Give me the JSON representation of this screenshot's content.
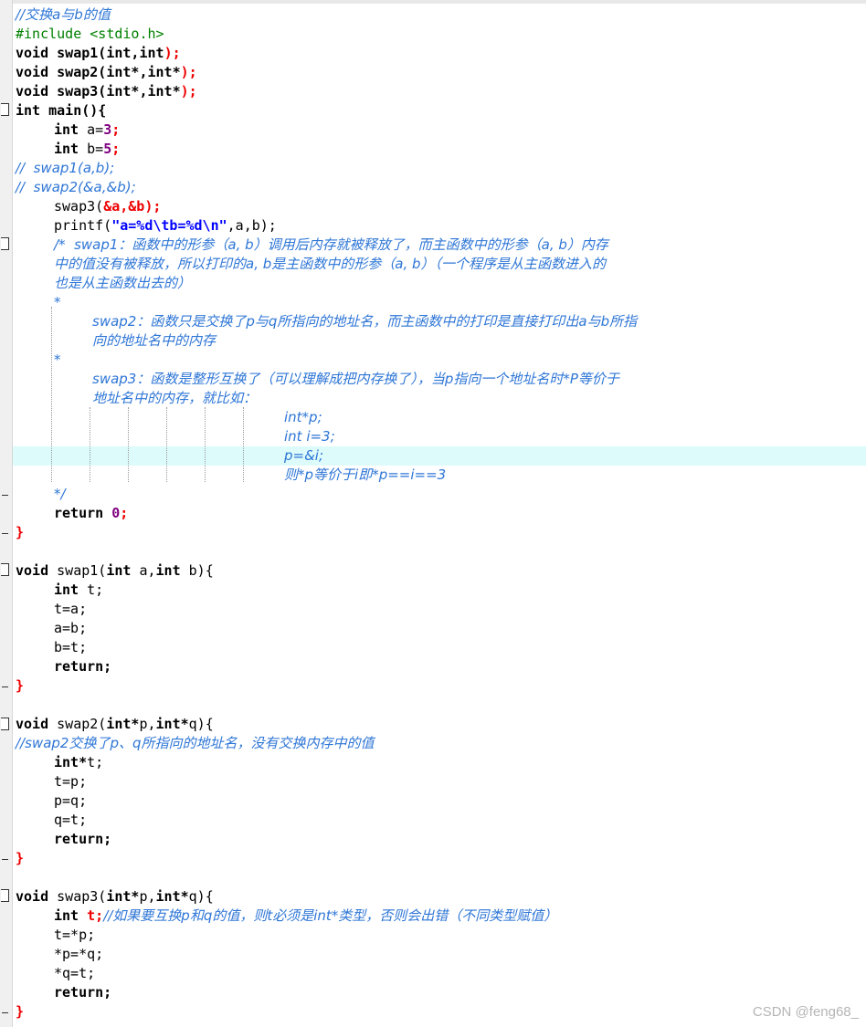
{
  "editor": {
    "lines": {
      "l1": "//交换a与b的值",
      "l2": "#include <stdio.h>",
      "l3a": "void",
      "l3b": " swap1(",
      "l3c": "int,int",
      "l3d": ");",
      "l4a": "void",
      "l4b": " swap2(",
      "l4c": "int*,int*",
      "l4d": ");",
      "l5a": "void",
      "l5b": " swap3(",
      "l5c": "int*,int*",
      "l5d": ");",
      "l6a": "int",
      "l6b": " main(){",
      "l7a": "int",
      "l7b": " a=",
      "l7c": "3",
      "l7d": ";",
      "l8a": "int",
      "l8b": " b=",
      "l8c": "5",
      "l8d": ";",
      "l9": "//  swap1(a,b);",
      "l10": "//  swap2(&a,&b);",
      "l11a": "swap3(",
      "l11b": "&a,&b",
      "l11c": ");",
      "l12a": "printf(",
      "l12b": "\"a=%d\\tb=%d\\n\"",
      "l12c": ",a,b);",
      "l13": "/*  swap1：函数中的形参（a, b）调用后内存就被释放了，而主函数中的形参（a, b）内存",
      "l14": "中的值没有被释放，所以打印的a, b是主函数中的形参（a, b）（一个程序是从主函数进入的",
      "l15": "也是从主函数出去的）",
      "l16": "*",
      "l17": "swap2：函数只是交换了p与q所指向的地址名，而主函数中的打印是直接打印出a与b所指",
      "l18": "向的地址名中的内存",
      "l19": "*",
      "l20": "swap3：函数是整形互换了（可以理解成把内存换了），当p指向一个地址名时*P等价于",
      "l21": "地址名中的内存，就比如：",
      "l22": "int*p;",
      "l23": "int i=3;",
      "l24": "p=&i;",
      "l25": "则*p等价于i即*p==i==3",
      "l26": "*/",
      "l27a": "return",
      "l27b": " 0",
      "l27c": ";",
      "l28": "}",
      "l30a": "void",
      "l30b": " swap1(",
      "l30c": "int",
      "l30d": " a,",
      "l30e": "int",
      "l30f": " b){",
      "l31a": "int",
      "l31b": " t;",
      "l32": "t=a;",
      "l33": "a=b;",
      "l34": "b=t;",
      "l35": "return;",
      "l36": "}",
      "l38a": "void",
      "l38b": " swap2(",
      "l38c": "int*",
      "l38d": "p,",
      "l38e": "int*",
      "l38f": "q){",
      "l39": "//swap2交换了p、q所指向的地址名，没有交换内存中的值",
      "l40a": "int*",
      "l40b": "t;",
      "l41": "t=p;",
      "l42": "p=q;",
      "l43": "q=t;",
      "l44": "return;",
      "l45": "}",
      "l47a": "void",
      "l47b": " swap3(",
      "l47c": "int*",
      "l47d": "p,",
      "l47e": "int*",
      "l47f": "q){",
      "l48a": "int",
      "l48b": " t;",
      "l48c": "//如果要互换p和q的值，则t必须是int*类型，否则会出错（不同类型赋值）",
      "l49": "t=*p;",
      "l50": "*p=*q;",
      "l51": "*q=t;",
      "l52": "return;",
      "l53": "}"
    }
  },
  "watermark": "CSDN @feng68_",
  "colors": {
    "comment": "#2e76d6",
    "preprocessor": "#008000",
    "operator": "#ee0000",
    "number": "#800080",
    "string": "#0000ff",
    "highlight_line": "#ddfbfb"
  }
}
